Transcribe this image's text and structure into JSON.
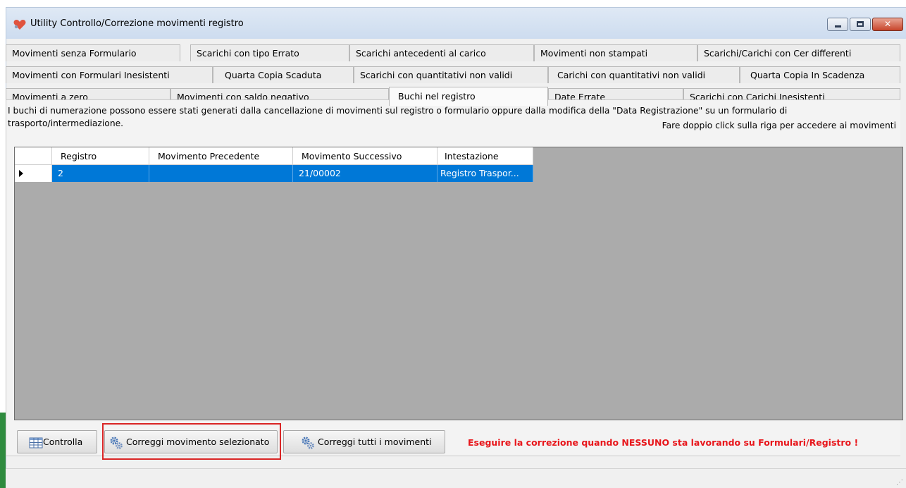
{
  "window": {
    "title": "Utility Controllo/Correzione movimenti registro"
  },
  "tabs": {
    "row1": [
      {
        "label": "Movimenti senza Formulario"
      },
      {
        "label": "Scarichi con tipo Errato"
      },
      {
        "label": "Scarichi antecedenti al carico"
      },
      {
        "label": "Movimenti non stampati"
      },
      {
        "label": "Scarichi/Carichi con Cer differenti"
      }
    ],
    "row2": [
      {
        "label": "Movimenti con Formulari Inesistenti"
      },
      {
        "label": "Quarta Copia Scaduta"
      },
      {
        "label": "Scarichi con quantitativi non validi"
      },
      {
        "label": "Carichi con quantitativi non validi"
      },
      {
        "label": "Quarta Copia In Scadenza"
      }
    ],
    "row3": [
      {
        "label": "Movimenti a zero"
      },
      {
        "label": "Movimenti con saldo negativo"
      },
      {
        "label": "Buchi nel registro",
        "active": true
      },
      {
        "label": "Date Errate"
      },
      {
        "label": "Scarichi con Carichi Inesistenti"
      }
    ]
  },
  "panel": {
    "description": "I buchi di numerazione possono essere stati generati dalla cancellazione di movimenti sul registro o formulario oppure dalla modifica della \"Data Registrazione\" su un formulario di trasporto/intermediazione.",
    "hint": "Fare doppio click sulla riga per accedere ai movimenti"
  },
  "grid": {
    "columns": [
      "Registro",
      "Movimento Precedente",
      "Movimento Successivo",
      "Intestazione"
    ],
    "rows": [
      {
        "registro": "2",
        "precedente": "",
        "successivo": "21/00002",
        "intestazione": "Registro Traspor..."
      }
    ]
  },
  "buttons": {
    "controlla": "Controlla",
    "correggi_selezionato": "Correggi movimento selezionato",
    "correggi_tutti": "Correggi tutti i movimenti"
  },
  "warning": "Eseguire la correzione quando NESSUNO sta lavorando su Formulari/Registro !",
  "colors": {
    "selection": "#0078d7",
    "warning": "#e8161b",
    "highlight_box": "#d92525",
    "grid_background": "#ababab"
  },
  "icons": {
    "app": "heart-icon",
    "controlla": "table-grid-icon",
    "correggi": "gears-icon"
  }
}
